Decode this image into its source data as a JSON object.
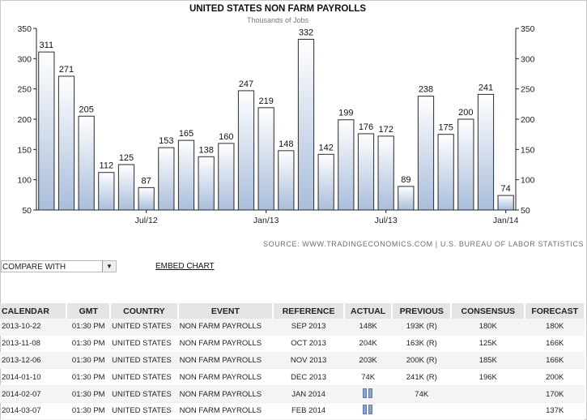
{
  "chart_data": {
    "type": "bar",
    "title": "UNITED STATES NON FARM PAYROLLS",
    "subtitle": "Thousands of Jobs",
    "values": [
      311,
      271,
      205,
      112,
      125,
      87,
      153,
      165,
      138,
      160,
      247,
      219,
      148,
      332,
      142,
      199,
      176,
      172,
      89,
      238,
      175,
      200,
      241,
      74
    ],
    "x_tick_labels": [
      {
        "label": "Jul/12",
        "index": 5
      },
      {
        "label": "Jan/13",
        "index": 11
      },
      {
        "label": "Jul/13",
        "index": 17
      },
      {
        "label": "Jan/14",
        "index": 23
      }
    ],
    "y_ticks": [
      50,
      100,
      150,
      200,
      250,
      300,
      350
    ],
    "ylim": [
      50,
      350
    ],
    "grid": false,
    "colors": {
      "bar_top": "#ffffff",
      "bar_bottom": "#a9bddb",
      "bar_border": "#2b2b2b"
    }
  },
  "source": "SOURCE: WWW.TRADINGECONOMICS.COM | U.S. BUREAU OF LABOR STATISTICS",
  "controls": {
    "compare_label": "COMPARE WITH",
    "embed_label": "EMBED CHART"
  },
  "calendar": {
    "headers": [
      "CALENDAR",
      "GMT",
      "COUNTRY",
      "EVENT",
      "REFERENCE",
      "ACTUAL",
      "PREVIOUS",
      "CONSENSUS",
      "FORECAST"
    ],
    "rows": [
      [
        "2013-10-22",
        "01:30 PM",
        "UNITED STATES",
        "NON FARM PAYROLLS",
        "SEP 2013",
        "148K",
        "193K (R)",
        "180K",
        "180K"
      ],
      [
        "2013-11-08",
        "01:30 PM",
        "UNITED STATES",
        "NON FARM PAYROLLS",
        "OCT 2013",
        "204K",
        "163K (R)",
        "125K",
        "166K"
      ],
      [
        "2013-12-06",
        "01:30 PM",
        "UNITED STATES",
        "NON FARM PAYROLLS",
        "NOV 2013",
        "203K",
        "200K (R)",
        "185K",
        "166K"
      ],
      [
        "2014-01-10",
        "01:30 PM",
        "UNITED STATES",
        "NON FARM PAYROLLS",
        "DEC 2013",
        "74K",
        "241K (R)",
        "196K",
        "200K"
      ],
      [
        "2014-02-07",
        "01:30 PM",
        "UNITED STATES",
        "NON FARM PAYROLLS",
        "JAN 2014",
        "",
        "74K",
        "",
        "170K"
      ],
      [
        "2014-03-07",
        "01:30 PM",
        "UNITED STATES",
        "NON FARM PAYROLLS",
        "FEB 2014",
        "",
        "",
        "",
        "137K"
      ]
    ]
  }
}
